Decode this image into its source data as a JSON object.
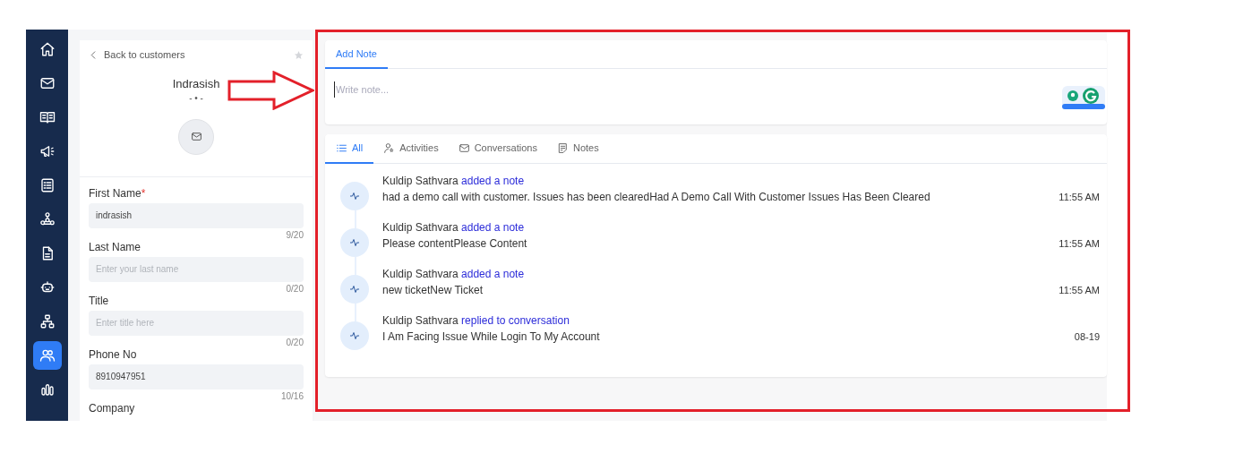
{
  "sidebar": {
    "items": [
      {
        "kind": "home",
        "selected": false
      },
      {
        "kind": "mail",
        "selected": false
      },
      {
        "kind": "book",
        "selected": false
      },
      {
        "kind": "megaphone",
        "selected": false
      },
      {
        "kind": "checklist",
        "selected": false
      },
      {
        "kind": "network",
        "selected": false
      },
      {
        "kind": "document",
        "selected": false
      },
      {
        "kind": "robot",
        "selected": false
      },
      {
        "kind": "hierarchy",
        "selected": false
      },
      {
        "kind": "users",
        "selected": true
      },
      {
        "kind": "chart",
        "selected": false
      }
    ]
  },
  "customer": {
    "back_link": "Back to customers",
    "starred": false,
    "name": "Indrasish",
    "status_text": "- • -",
    "fields": [
      {
        "label": "First Name",
        "required_mark": "*",
        "value": "indrasish",
        "counter": "9/20"
      },
      {
        "label": "Last Name",
        "placeholder": "Enter your last name",
        "counter": "0/20"
      },
      {
        "label": "Title",
        "placeholder": "Enter title here",
        "counter": "0/20"
      },
      {
        "label": "Phone No",
        "value": "8910947951",
        "counter": "10/16"
      },
      {
        "label": "Company"
      }
    ]
  },
  "note_editor": {
    "tabs": [
      {
        "label": "Add Note",
        "selected": true
      }
    ],
    "placeholder": "Write note..."
  },
  "activity_tabs": [
    {
      "kind": "list",
      "label": "All",
      "selected": true
    },
    {
      "kind": "activities",
      "label": "Activities",
      "selected": false
    },
    {
      "kind": "mail",
      "label": "Conversations",
      "selected": false
    },
    {
      "kind": "note",
      "label": "Notes",
      "selected": false
    }
  ],
  "activities": [
    {
      "author": "Kuldip Sathvara",
      "action": "added a note",
      "body": "had a demo call with customer. Issues has been clearedHad A Demo Call With Customer Issues Has Been Cleared",
      "time": "11:55 AM"
    },
    {
      "author": "Kuldip Sathvara",
      "action": "added a note",
      "body": "Please contentPlease Content",
      "time": "11:55 AM"
    },
    {
      "author": "Kuldip Sathvara",
      "action": "added a note",
      "body": "new ticketNew Ticket",
      "time": "11:55 AM"
    },
    {
      "author": "Kuldip Sathvara",
      "action": "replied to conversation",
      "body": "I Am Facing Issue While Login To My Account",
      "time": "08-19"
    }
  ]
}
